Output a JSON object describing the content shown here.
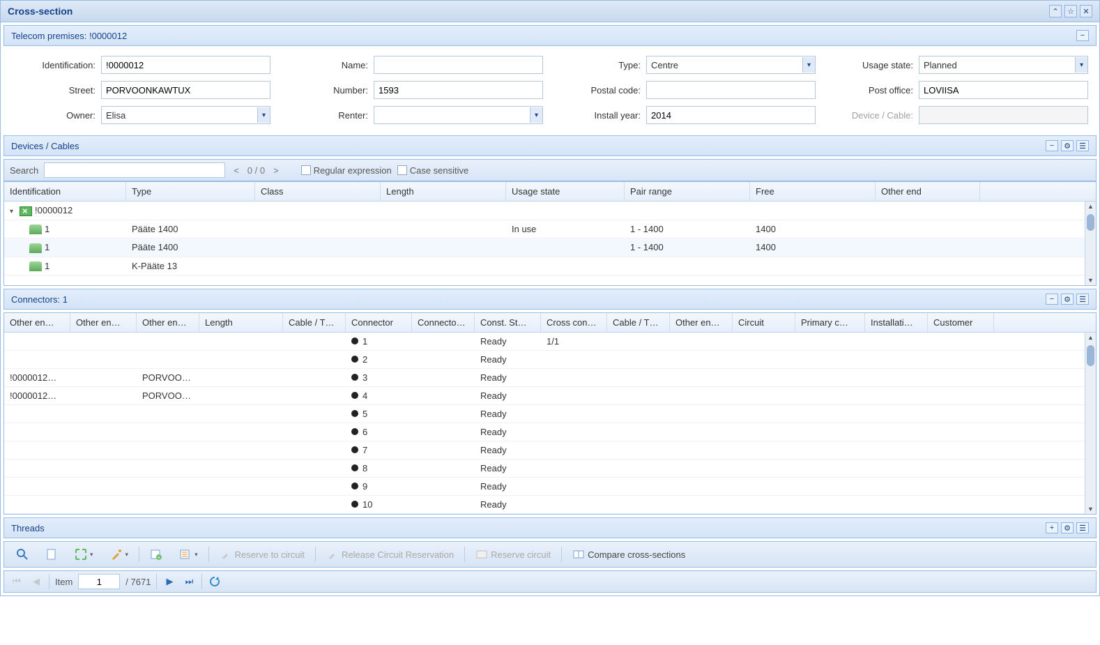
{
  "window": {
    "title": "Cross-section"
  },
  "telecom": {
    "header": "Telecom premises: !0000012",
    "labels": {
      "identification": "Identification:",
      "name": "Name:",
      "type": "Type:",
      "usage_state": "Usage state:",
      "street": "Street:",
      "number": "Number:",
      "postal": "Postal code:",
      "post_office": "Post office:",
      "owner": "Owner:",
      "renter": "Renter:",
      "install_year": "Install year:",
      "device_cable": "Device / Cable:"
    },
    "values": {
      "identification": "!0000012",
      "name": "",
      "type": "Centre",
      "usage_state": "Planned",
      "street": "PORVOONKAWTUX",
      "number": "1593",
      "postal": "",
      "post_office": "LOVIISA",
      "owner": "Elisa",
      "renter": "",
      "install_year": "2014",
      "device_cable": ""
    }
  },
  "devices": {
    "header": "Devices / Cables",
    "search_label": "Search",
    "counter": "0 / 0",
    "regex_label": "Regular expression",
    "case_label": "Case sensitive",
    "columns": [
      "Identification",
      "Type",
      "Class",
      "Length",
      "Usage state",
      "Pair range",
      "Free",
      "Other end"
    ],
    "root": "!0000012",
    "rows": [
      {
        "id": "1",
        "type": "Pääte 1400",
        "usage": "In use",
        "pair": "1 - 1400",
        "free": "1400"
      },
      {
        "id": "1",
        "type": "Pääte 1400",
        "usage": "",
        "pair": "1 - 1400",
        "free": "1400",
        "selected": true
      },
      {
        "id": "1",
        "type": "K-Pääte 13",
        "usage": "",
        "pair": "",
        "free": ""
      }
    ]
  },
  "connectors": {
    "header": "Connectors: 1",
    "columns": [
      "Other en…",
      "Other en…",
      "Other en…",
      "Length",
      "Cable / T…",
      "Connector",
      "Connecto…",
      "Const. St…",
      "Cross con…",
      "Cable / T…",
      "Other en…",
      "Circuit",
      "Primary c…",
      "Installati…",
      "Customer"
    ],
    "rows": [
      {
        "oe0": "",
        "oe2": "",
        "conn": "1",
        "cs": "Ready",
        "cc": "1/1"
      },
      {
        "oe0": "",
        "oe2": "",
        "conn": "2",
        "cs": "Ready",
        "cc": ""
      },
      {
        "oe0": "!0000012…",
        "oe2": "PORVOO…",
        "conn": "3",
        "cs": "Ready",
        "cc": ""
      },
      {
        "oe0": "!0000012…",
        "oe2": "PORVOO…",
        "conn": "4",
        "cs": "Ready",
        "cc": ""
      },
      {
        "oe0": "",
        "oe2": "",
        "conn": "5",
        "cs": "Ready",
        "cc": ""
      },
      {
        "oe0": "",
        "oe2": "",
        "conn": "6",
        "cs": "Ready",
        "cc": ""
      },
      {
        "oe0": "",
        "oe2": "",
        "conn": "7",
        "cs": "Ready",
        "cc": ""
      },
      {
        "oe0": "",
        "oe2": "",
        "conn": "8",
        "cs": "Ready",
        "cc": ""
      },
      {
        "oe0": "",
        "oe2": "",
        "conn": "9",
        "cs": "Ready",
        "cc": ""
      },
      {
        "oe0": "",
        "oe2": "",
        "conn": "10",
        "cs": "Ready",
        "cc": ""
      }
    ]
  },
  "threads": {
    "header": "Threads"
  },
  "actions": {
    "reserve_to_circuit": "Reserve to circuit",
    "release": "Release Circuit Reservation",
    "reserve_circuit": "Reserve circuit",
    "compare": "Compare cross-sections"
  },
  "pager": {
    "item_label": "Item",
    "current": "1",
    "total": "/ 7671"
  }
}
